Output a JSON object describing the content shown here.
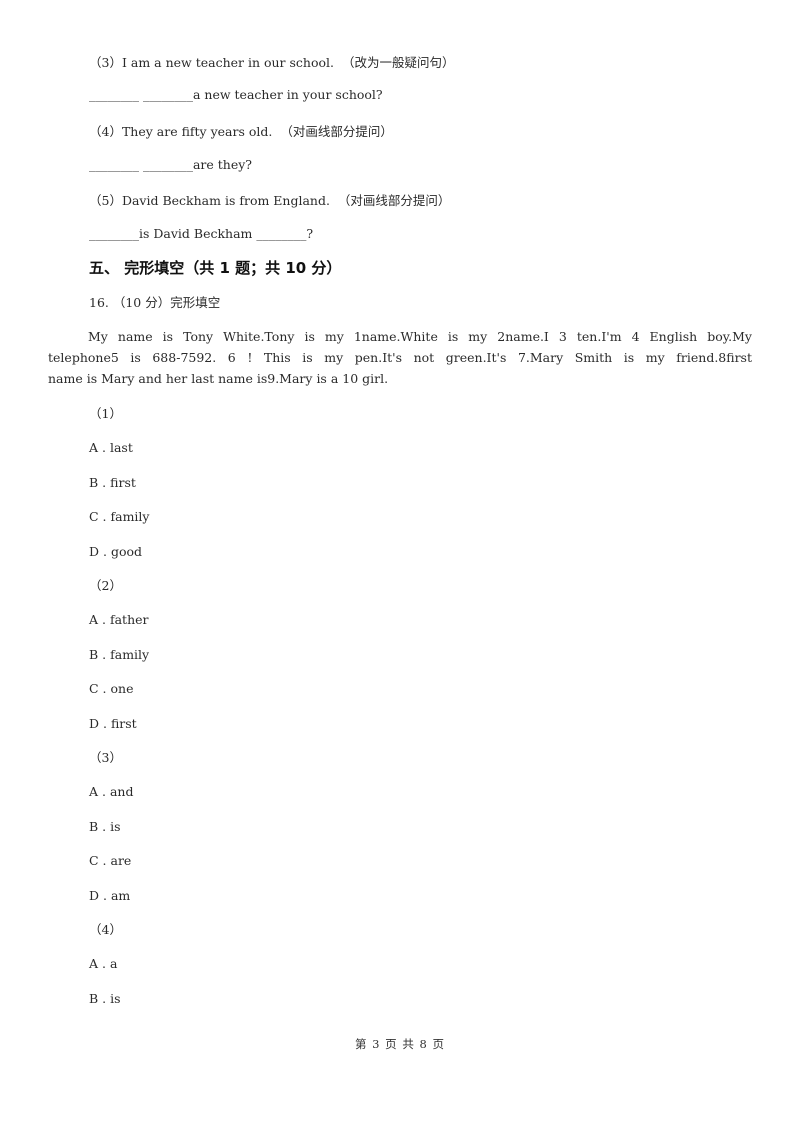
{
  "rewrite_items": [
    {
      "prompt": "（3）I am a new teacher in our school.  （改为一般疑问句）",
      "answer": "________ ________a new teacher in your school?"
    },
    {
      "prompt": "（4）They are fifty years old.  （对画线部分提问）",
      "answer": "________ ________are they?"
    },
    {
      "prompt": "（5）David Beckham is from England.  （对画线部分提问）",
      "answer": "________is David Beckham ________?"
    }
  ],
  "section": {
    "heading": "五、 完形填空（共 1 题；共 10 分）",
    "question_label": "16. （10 分）完形填空",
    "passage_lines": [
      "My  name  is  Tony  White.Tony  is  my  1name.White  is  my  2name.I  3 ten.I'm  4 English  boy.My",
      "telephone5 is 688-7592.  6 !  This  is  my  pen.It's  not  green.It's  7.Mary  Smith  is  my  friend.8first",
      "name is Mary and her last name is9.Mary is a 10 girl."
    ],
    "subquestions": [
      {
        "number": "（1）",
        "options": [
          {
            "letter": "A .",
            "text": "last"
          },
          {
            "letter": "B .",
            "text": "first"
          },
          {
            "letter": "C .",
            "text": "family"
          },
          {
            "letter": "D .",
            "text": "good"
          }
        ]
      },
      {
        "number": "（2）",
        "options": [
          {
            "letter": "A .",
            "text": "father"
          },
          {
            "letter": "B .",
            "text": "family"
          },
          {
            "letter": "C .",
            "text": "one"
          },
          {
            "letter": "D .",
            "text": "first"
          }
        ]
      },
      {
        "number": "（3）",
        "options": [
          {
            "letter": "A .",
            "text": "and"
          },
          {
            "letter": "B .",
            "text": "is"
          },
          {
            "letter": "C .",
            "text": "are"
          },
          {
            "letter": "D .",
            "text": "am"
          }
        ]
      },
      {
        "number": "（4）",
        "options": [
          {
            "letter": "A .",
            "text": "a"
          },
          {
            "letter": "B .",
            "text": "is"
          }
        ]
      }
    ]
  },
  "footer": {
    "page_indicator": "第 3 页 共 8 页"
  }
}
